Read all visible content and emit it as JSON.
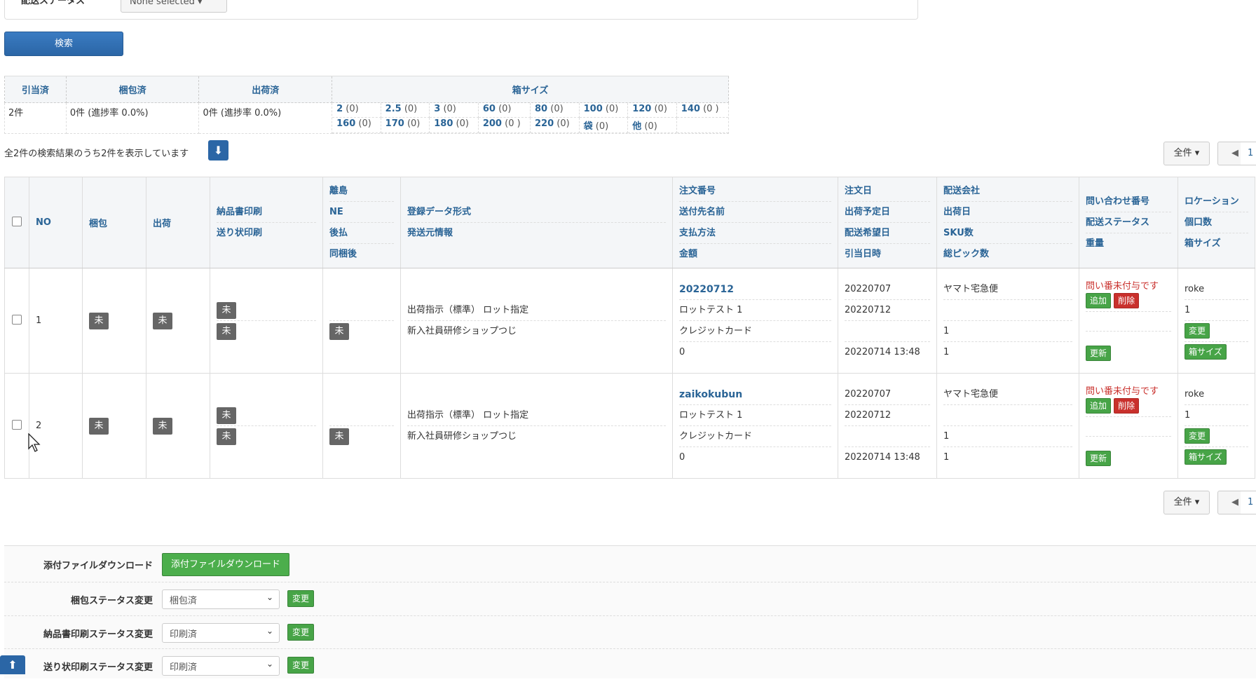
{
  "filter": {
    "label": "配送ステータス",
    "status_value": "None selected ▾"
  },
  "search_label": "検索",
  "summary": {
    "headers": [
      "引当済",
      "梱包済",
      "出荷済",
      "箱サイズ"
    ],
    "allocated": "2件",
    "packed": "0件 (進捗率 0.0%)",
    "shipped": "0件 (進捗率 0.0%)",
    "sizes_row1": [
      {
        "size": "2",
        "count": "(0)"
      },
      {
        "size": "2.5",
        "count": "(0)"
      },
      {
        "size": "3",
        "count": "(0)"
      },
      {
        "size": "60",
        "count": "(0)"
      },
      {
        "size": "80",
        "count": "(0)"
      },
      {
        "size": "100",
        "count": "(0)"
      },
      {
        "size": "120",
        "count": "(0)"
      },
      {
        "size": "140",
        "count": "(0 )"
      }
    ],
    "sizes_row2": [
      {
        "size": "160",
        "count": "(0)"
      },
      {
        "size": "170",
        "count": "(0)"
      },
      {
        "size": "180",
        "count": "(0)"
      },
      {
        "size": "200",
        "count": "(0 )"
      },
      {
        "size": "220",
        "count": "(0)"
      },
      {
        "size": "袋",
        "count": "(0)"
      },
      {
        "size": "他",
        "count": "(0)"
      },
      {
        "size": "",
        "count": ""
      }
    ]
  },
  "result_text": "全2件の検索結果のうち2件を表示しています",
  "pager": {
    "all_label": "全件 ▾",
    "page": "1"
  },
  "table": {
    "headers": {
      "no": "NO",
      "pack": "梱包",
      "ship": "出荷",
      "print": [
        "納品書印刷",
        "送り状印刷"
      ],
      "island": [
        "離島",
        "NE",
        "後払",
        "同梱後"
      ],
      "format": [
        "登録データ形式",
        "発送元情報"
      ],
      "order": [
        "注文番号",
        "送付先名前",
        "支払方法",
        "金額"
      ],
      "dates": [
        "注文日",
        "出荷予定日",
        "配送希望日",
        "引当日時"
      ],
      "delivery": [
        "配送会社",
        "出荷日",
        "SKU数",
        "総ピック数"
      ],
      "inquiry": [
        "問い合わせ番号",
        "配送ステータス",
        "重量"
      ],
      "location": [
        "ロケーション",
        "個口数",
        "箱サイズ"
      ]
    },
    "badge": "未",
    "add_label": "追加",
    "delete_label": "削除",
    "update_label": "更新",
    "change_label": "変更",
    "box_size_label": "箱サイズ",
    "rows": [
      {
        "no": "1",
        "format": "出荷指示（標準） ロット指定",
        "origin": "新入社員研修ショップつじ",
        "order_no": "20220712",
        "recipient": "ロットテスト 1",
        "payment": "クレジットカード",
        "amount": "0",
        "order_date": "20220707",
        "ship_plan": "20220712",
        "delivery_wish": "",
        "alloc_time": "20220714 13:48",
        "carrier": "ヤマト宅急便",
        "ship_date": "",
        "sku": "1",
        "pick": "1",
        "inquiry_warn": "問い番未付与です",
        "location": "roke",
        "parcels": "1"
      },
      {
        "no": "2",
        "format": "出荷指示（標準） ロット指定",
        "origin": "新入社員研修ショップつじ",
        "order_no": "zaikokubun",
        "recipient": "ロットテスト 1",
        "payment": "クレジットカード",
        "amount": "0",
        "order_date": "20220707",
        "ship_plan": "20220712",
        "delivery_wish": "",
        "alloc_time": "20220714 13:48",
        "carrier": "ヤマト宅急便",
        "ship_date": "",
        "sku": "1",
        "pick": "1",
        "inquiry_warn": "問い番未付与です",
        "location": "roke",
        "parcels": "1"
      }
    ]
  },
  "bottom": {
    "attach_label": "添付ファイルダウンロード",
    "attach_button": "添付ファイルダウンロード",
    "pack_status_label": "梱包ステータス変更",
    "pack_status_value": "梱包済",
    "invoice_status_label": "納品書印刷ステータス変更",
    "invoice_status_value": "印刷済",
    "label_status_label": "送り状印刷ステータス変更",
    "label_status_value": "印刷済",
    "change_label": "変更"
  }
}
